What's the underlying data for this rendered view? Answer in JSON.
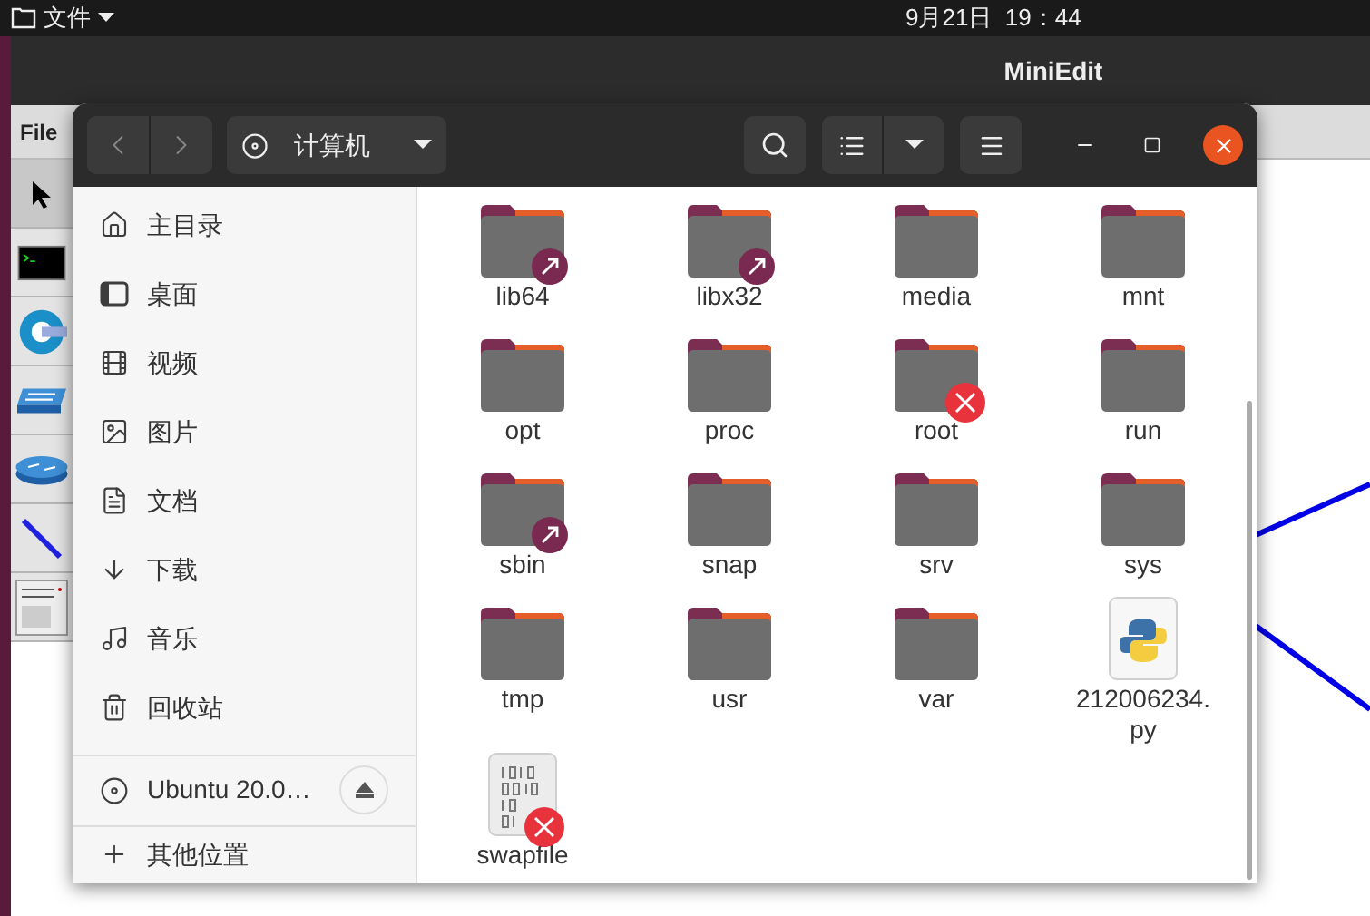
{
  "top_bar": {
    "app_menu": "文件",
    "clock": "9月21日  19：44"
  },
  "miniedit": {
    "title": "MiniEdit",
    "menu": [
      "File"
    ],
    "tools": [
      {
        "kind": "select",
        "selected": true
      },
      {
        "kind": "host",
        "selected": false
      },
      {
        "kind": "controller",
        "selected": false
      },
      {
        "kind": "switch",
        "selected": false
      },
      {
        "kind": "router",
        "selected": false
      },
      {
        "kind": "link",
        "selected": false
      },
      {
        "kind": "netlink",
        "selected": false
      }
    ]
  },
  "files_window": {
    "location": "计算机",
    "sidebar": {
      "places": [
        {
          "kind": "home",
          "label": "主目录"
        },
        {
          "kind": "desktop",
          "label": "桌面"
        },
        {
          "kind": "video",
          "label": "视频"
        },
        {
          "kind": "picture",
          "label": "图片"
        },
        {
          "kind": "document",
          "label": "文档"
        },
        {
          "kind": "download",
          "label": "下载"
        },
        {
          "kind": "music",
          "label": "音乐"
        },
        {
          "kind": "trash",
          "label": "回收站"
        }
      ],
      "devices": [
        {
          "label": "Ubuntu 20.0…"
        }
      ],
      "other": "其他位置"
    },
    "files": [
      {
        "name": "lib64",
        "kind": "folder",
        "linked": true,
        "locked": false
      },
      {
        "name": "libx32",
        "kind": "folder",
        "linked": true,
        "locked": false
      },
      {
        "name": "media",
        "kind": "folder",
        "linked": false,
        "locked": false
      },
      {
        "name": "mnt",
        "kind": "folder",
        "linked": false,
        "locked": false
      },
      {
        "name": "opt",
        "kind": "folder",
        "linked": false,
        "locked": false
      },
      {
        "name": "proc",
        "kind": "folder",
        "linked": false,
        "locked": false
      },
      {
        "name": "root",
        "kind": "folder",
        "linked": false,
        "locked": true
      },
      {
        "name": "run",
        "kind": "folder",
        "linked": false,
        "locked": false
      },
      {
        "name": "sbin",
        "kind": "folder",
        "linked": true,
        "locked": false
      },
      {
        "name": "snap",
        "kind": "folder",
        "linked": false,
        "locked": false
      },
      {
        "name": "srv",
        "kind": "folder",
        "linked": false,
        "locked": false
      },
      {
        "name": "sys",
        "kind": "folder",
        "linked": false,
        "locked": false
      },
      {
        "name": "tmp",
        "kind": "folder",
        "linked": false,
        "locked": false
      },
      {
        "name": "usr",
        "kind": "folder",
        "linked": false,
        "locked": false
      },
      {
        "name": "var",
        "kind": "folder",
        "linked": false,
        "locked": false
      },
      {
        "name": "212006234.\npy",
        "kind": "python",
        "linked": false,
        "locked": false
      },
      {
        "name": "swapfile",
        "kind": "binary",
        "linked": false,
        "locked": true
      }
    ]
  }
}
